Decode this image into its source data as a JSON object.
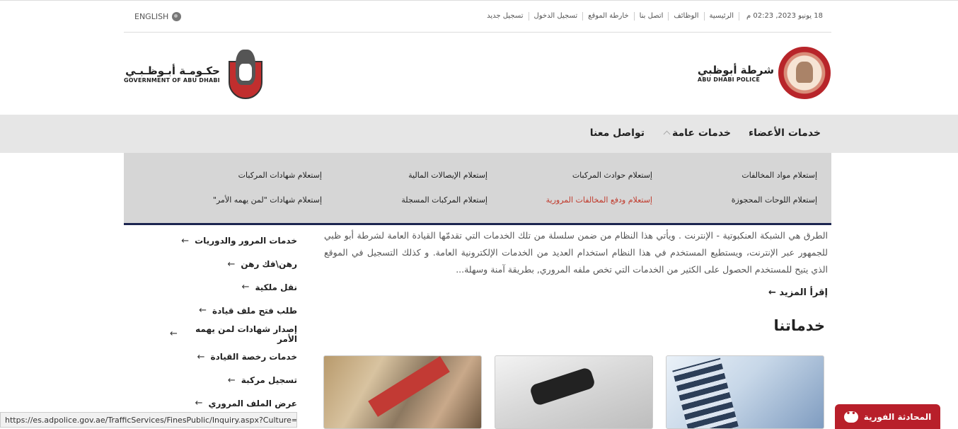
{
  "util": {
    "date": "18 يونيو 2023, 02:23 م",
    "links": [
      "الرئيسية",
      "الوظائف",
      "اتصل بنا",
      "خارطة الموقع",
      "تسجيل الدخول",
      "تسجيل جديد"
    ],
    "english": "ENGLISH"
  },
  "logos": {
    "police_ar": "شرطة أبوظبي",
    "police_en": "ABU DHABI POLICE",
    "gov_ar": "حكـومـة أبـوظـبـي",
    "gov_en": "GOVERNMENT OF ABU DHABI"
  },
  "nav": {
    "members": "خدمات الأعضاء",
    "general": "خدمات عامة",
    "contact": "تواصل معنا"
  },
  "mega": [
    "إستعلام مواد المخالفات",
    "إستعلام حوادث المركبات",
    "إستعلام الإيصالات المالية",
    "إستعلام شهادات المركبات",
    "إستعلام اللوحات المحجوزة",
    "إستعلام ودفع المخالفات المرورية",
    "إستعلام المركبات المسجلة",
    "إستعلام شهادات \"لمن يهمه الأمر\""
  ],
  "intro": "الطرق هي الشبكة العنكبوتية - الإنترنت . ويأتي هذا النظام من ضمن سلسلة من تلك الخدمات التي تقدمّها القيادة العامة لشرطة أبو ظبي للجمهور عبر الإنترنت، ويستطيع المستخدم في هذا النظام استخدام العديد من الخدمات الإلكترونية العامة. و كذلك التسجيل في الموقع الذي يتيح للمستخدم الحصول على الكثير من الخدمات التي تخص ملفه المروري, بطريقة آمنة وسهلة...",
  "readmore": "إقرأ المزيد",
  "services_title": "خدماتنا",
  "sidebar": [
    "خدمات المرور والدوريات",
    "رهن\\فك رهن",
    "نقل ملكية",
    "طلب فتح ملف قيادة",
    "إصدار شهادات لمن يهمه الأمر",
    "خدمات رخصة القيادة",
    "تسجيل مركبة",
    "عرض الملف المروري"
  ],
  "status_url": "https://es.adpolice.gov.ae/TrafficServices/FinesPublic/Inquiry.aspx?Culture=ar",
  "chat_label": "المحادثة الفورية"
}
